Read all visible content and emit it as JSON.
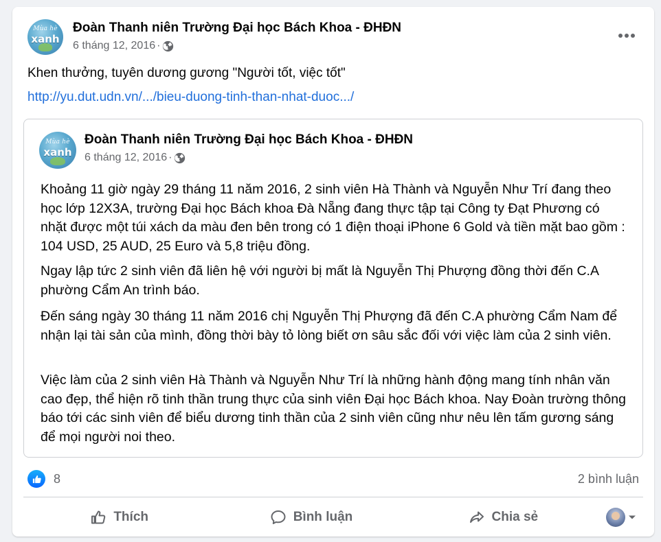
{
  "post": {
    "author": "Đoàn Thanh niên Trường Đại học Bách Khoa - ĐHĐN",
    "date": "6 tháng 12, 2016",
    "separator": "·",
    "avatar": {
      "top_text": "Mùa hè",
      "main_text": "xanh"
    },
    "text": "Khen thưởng, tuyên dương gương \"Người tốt, việc tốt\"",
    "link": "http://yu.dut.udn.vn/.../bieu-duong-tinh-than-nhat-duoc.../"
  },
  "shared": {
    "author": "Đoàn Thanh niên Trường Đại học Bách Khoa - ĐHĐN",
    "date": "6 tháng 12, 2016",
    "separator": "·",
    "avatar": {
      "top_text": "Mùa hè",
      "main_text": "xanh"
    },
    "paragraphs": [
      "Khoảng 11 giờ ngày 29 tháng 11 năm 2016, 2 sinh viên Hà Thành và Nguyễn Như Trí đang theo học lớp 12X3A, trường Đại học Bách khoa Đà Nẵng đang thực tập tại Công ty Đạt Phương có nhặt được một túi xách da màu đen bên trong có 1 điện thoại iPhone 6 Gold và tiền mặt bao gồm : 104 USD, 25 AUD, 25 Euro và 5,8 triệu đồng.",
      "Ngay lập tức 2 sinh viên đã liên hệ với người bị mất là Nguyễn Thị Phượng đồng thời đến C.A phường Cẩm An trình báo.",
      "Đến sáng ngày 30 tháng 11 năm 2016 chị Nguyễn Thị Phượng đã đến C.A phường Cẩm Nam để nhận lại tài sản của mình, đồng thời bày tỏ lòng biết ơn sâu sắc đối với việc làm của 2 sinh viên.",
      "Việc làm của 2 sinh viên Hà Thành và Nguyễn Như Trí là những hành động mang tính nhân văn cao đẹp, thể hiện rõ tinh thần trung thực của sinh viên Đại học Bách khoa. Nay Đoàn trường thông báo tới các sinh viên để biểu dương tinh thần của 2 sinh viên cũng như nêu lên tấm gương sáng để mọi người noi theo."
    ]
  },
  "stats": {
    "likes": "8",
    "comments": "2 bình luận"
  },
  "actions": {
    "like": "Thích",
    "comment": "Bình luận",
    "share": "Chia sẻ"
  },
  "icons": {
    "more": "more-options-icon",
    "audience": "globe-icon",
    "like_reaction": "thumbs-up-icon",
    "like": "thumbs-up-outline-icon",
    "comment": "comment-icon",
    "share": "share-icon",
    "dropdown": "caret-down-icon"
  },
  "colors": {
    "link": "#216fdb",
    "like_badge": "#0866ff",
    "secondary_text": "#65676b"
  }
}
